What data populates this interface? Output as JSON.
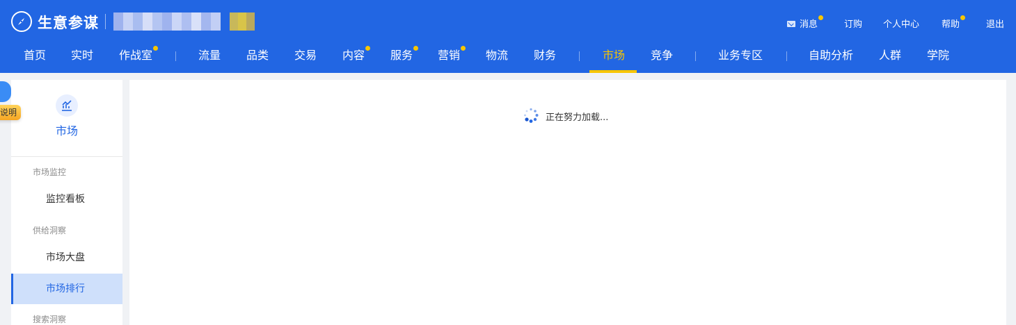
{
  "header": {
    "brand": "生意参谋",
    "utility": [
      {
        "label": "消息",
        "badge": true
      },
      {
        "label": "订购",
        "badge": false
      },
      {
        "label": "个人中心",
        "badge": false
      },
      {
        "label": "帮助",
        "badge": true
      },
      {
        "label": "退出",
        "badge": false
      }
    ]
  },
  "nav": {
    "items": [
      {
        "label": "首页",
        "badge": false
      },
      {
        "label": "实时",
        "badge": false
      },
      {
        "label": "作战室",
        "badge": true
      },
      {
        "label": "流量",
        "badge": false
      },
      {
        "label": "品类",
        "badge": false
      },
      {
        "label": "交易",
        "badge": false
      },
      {
        "label": "内容",
        "badge": true
      },
      {
        "label": "服务",
        "badge": true
      },
      {
        "label": "营销",
        "badge": true
      },
      {
        "label": "物流",
        "badge": false
      },
      {
        "label": "财务",
        "badge": false
      },
      {
        "label": "市场",
        "badge": false,
        "active": true
      },
      {
        "label": "竞争",
        "badge": false
      },
      {
        "label": "业务专区",
        "badge": false
      },
      {
        "label": "自助分析",
        "badge": false
      },
      {
        "label": "人群",
        "badge": false
      },
      {
        "label": "学院",
        "badge": false
      }
    ]
  },
  "sidebar": {
    "title": "市场",
    "icon": "market-chart-icon",
    "groups": [
      {
        "label": "市场监控",
        "items": [
          {
            "label": "监控看板"
          }
        ]
      },
      {
        "label": "供给洞察",
        "items": [
          {
            "label": "市场大盘"
          },
          {
            "label": "市场排行",
            "active": true
          }
        ]
      },
      {
        "label": "搜索洞察",
        "items": []
      }
    ]
  },
  "helper": {
    "tag": "说明"
  },
  "main": {
    "loading_text": "正在努力加载..."
  },
  "colors": {
    "primary": "#2266e3",
    "accent": "#f7c600",
    "active_bg": "#cfe0fb",
    "page_bg": "#f0f2f5"
  }
}
